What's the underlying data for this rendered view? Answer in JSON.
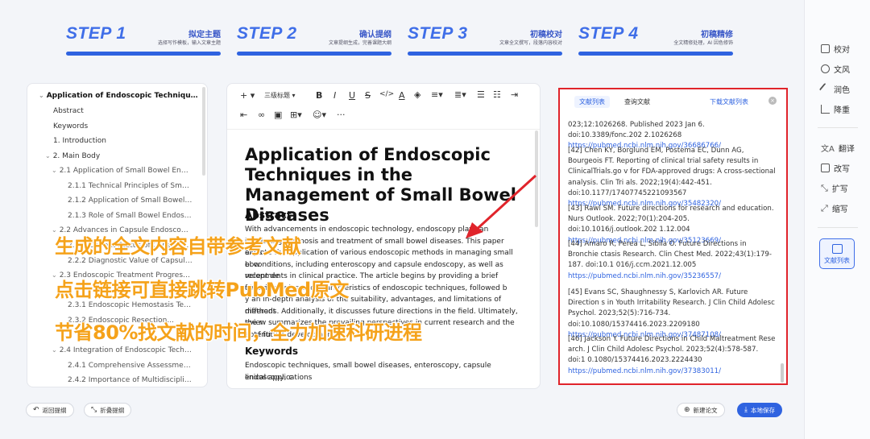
{
  "steps": [
    {
      "num": "STEP 1",
      "title": "拟定主题",
      "desc": "选择写作模板，输入文章主题"
    },
    {
      "num": "STEP 2",
      "title": "确认提纲",
      "desc": "文章提纲生成，完善课题大纲"
    },
    {
      "num": "STEP 3",
      "title": "初稿校对",
      "desc": "文章全文撰写，段落内容校对"
    },
    {
      "num": "STEP 4",
      "title": "初稿精修",
      "desc": "全文精修处理，AI 因色修饰"
    }
  ],
  "sidebar_tools": {
    "proofread": "校对",
    "style": "文风",
    "polish": "润色",
    "reduce": "降重",
    "translate": "翻译",
    "rewrite": "改写",
    "expand": "扩写",
    "shorten": "缩写",
    "references": "文献列表"
  },
  "outline": {
    "root": "Application of Endoscopic Techniques i...",
    "items": [
      "Abstract",
      "Keywords",
      "1. Introduction",
      "2. Main Body",
      "2.1 Application of Small Bowel Endo...",
      "2.1.1 Technical Principles of Small ...",
      "2.1.2 Application of Small Bowel E...",
      "2.1.3 Role of Small Bowel Endosco...",
      "2.2 Advances in Capsule Endoscopy ...",
      "2.2.1 Current Status of Capsule Endo...",
      "2.2.2 Diagnostic Value of Capsule E...",
      "2.3 Endoscopic Treatment Progress...",
      "2.3.1 Endoscopic Hemostasis Tech...",
      "2.3.2 Endoscopic Resection...",
      "2.4 Integration of Endoscopic Techn...",
      "2.4.1 Comprehensive Assessment ...",
      "2.4.2 Importance of Multidisciplina..."
    ]
  },
  "editor": {
    "toolbar": {
      "insert": "+",
      "heading": "三级标题",
      "bold": "B",
      "italic": "I",
      "underline": "U",
      "strike": "S",
      "code": "</>",
      "color": "A",
      "more": "···"
    },
    "title": "Application of Endoscopic Techniques in the Management of Small Bowel Diseases",
    "abstract_heading": "Abstract",
    "abstract_lines": [
      "With advancements in endoscopic technology, endoscopy plays an increasingly v",
      "role in the diagnosis and treatment of small bowel diseases. This paper aims t",
      "explore the application of various endoscopic methods in managing small bow",
      "el conditions, including enteroscopy and capsule endoscopy, as well as recent de",
      "velopments in clinical practice. The article begins by providing a brief overview o",
      "f the principles and characteristics of endoscopic techniques, followed b",
      "y an in-depth analysis of the suitability, advantages, and limitations of different",
      "methods. Additionally, it discusses future directions in the field. Ultimately, the r",
      "eview summarizes the prevailing perspectives in current research and the potenti",
      "al of future developments."
    ],
    "keywords_heading": "Keywords",
    "keywords_lines": [
      "Endoscopic techniques, small bowel diseases, enteroscopy, capsule endoscopy, c",
      "linical applications"
    ]
  },
  "references": {
    "tab_list": "文献列表",
    "tab_search": "查询文献",
    "download": "下载文献列表",
    "close": "×",
    "entries": [
      {
        "text": "023;12:1026268. Published 2023 Jan 6. doi:10.3389/fonc.202 2.1026268 ",
        "link": "https://pubmed.ncbi.nlm.nih.gov/36686766/"
      },
      {
        "text": "[42] Chen KY, Borglund EM, Postema EC, Dunn AG, Bourgeois FT. Reporting of clinical trial safety results in ClinicalTrials.go v for FDA-approved drugs: A cross-sectional analysis. Clin Tri als. 2022;19(4):442-451. doi:10.1177/17407745221093567 ",
        "link": "https://pubmed.ncbi.nlm.nih.gov/35482320/"
      },
      {
        "text": "[43] Rawl SM. Future directions for research and education. Nurs Outlook. 2022;70(1):204-205. doi:10.1016/j.outlook.202 1.12.004 ",
        "link": "https://pubmed.ncbi.nlm.nih.gov/35123669/"
      },
      {
        "text": "[44] Amaro R, Perea L, Sibila O. Future Directions in Bronchie ctasis Research. Clin Chest Med. 2022;43(1):179-187. doi:10.1 016/j.ccm.2021.12.005 ",
        "link": "https://pubmed.ncbi.nlm.nih.gov/35236557/"
      },
      {
        "text": "[45] Evans SC, Shaughnessy S, Karlovich AR. Future Direction s in Youth Irritability Research. J Clin Child Adolesc Psychol. 2023;52(5):716-734. doi:10.1080/15374416.2023.2209180 ",
        "link": "https://pubmed.ncbi.nlm.nih.gov/37487108/"
      },
      {
        "text": "[46] Jackson Y. Future Directions in Child Maltreatment Rese arch. J Clin Child Adolesc Psychol. 2023;52(4):578-587. doi:1 0.1080/15374416.2023.2224430 ",
        "link": "https://pubmed.ncbi.nlm.nih.gov/37383011/"
      }
    ]
  },
  "bottom": {
    "back": "返回提纲",
    "collapse": "折叠提纲",
    "new_paper": "新建论文",
    "save": "本地保存"
  },
  "overlay": {
    "line1": "生成的全文内容自带参考文献",
    "line2": "点击链接可直接跳转PubMed原文",
    "line3": "节省80%找文献的时间，全力加速科研进程"
  },
  "colors": {
    "accent": "#2f63e0",
    "highlight_border": "#e0242b",
    "overlay_text": "#f5a21a"
  }
}
